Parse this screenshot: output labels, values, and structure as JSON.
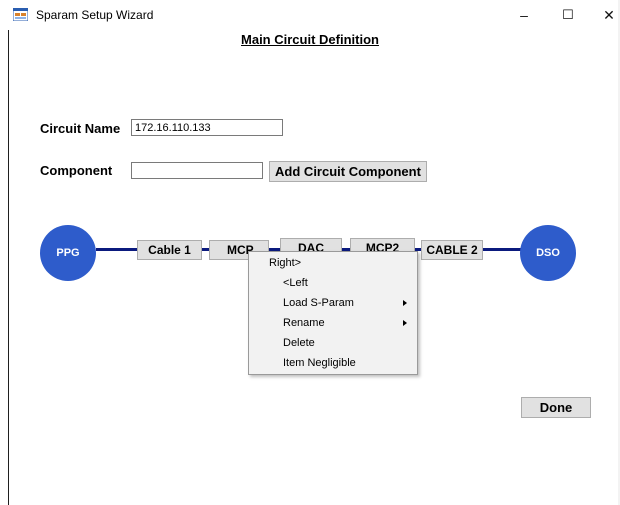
{
  "window": {
    "title": "Sparam Setup Wizard",
    "minimize_glyph": "–",
    "maximize_glyph": "☐",
    "close_glyph": "✕",
    "icon": "app-window-icon"
  },
  "main": {
    "heading": "Main Circuit Definition",
    "circuit_name_label": "Circuit Name",
    "circuit_name_value": "172.16.110.133",
    "component_label": "Component",
    "component_value": "",
    "add_button_label": "Add Circuit Component",
    "done_button_label": "Done"
  },
  "circuit": {
    "source_node": "PPG",
    "sink_node": "DSO",
    "components": [
      "Cable 1",
      "MCP",
      "DAC",
      "MCP2",
      "CABLE 2"
    ],
    "wire_color": "#0b1a7e",
    "node_color": "#2e5ccb"
  },
  "context_menu": {
    "items": [
      {
        "label": "Right>",
        "submenu": false
      },
      {
        "label": "<Left",
        "submenu": false
      },
      {
        "label": "Load S-Param",
        "submenu": true
      },
      {
        "label": "Rename",
        "submenu": true
      },
      {
        "label": "Delete",
        "submenu": false
      },
      {
        "label": "Item Negligible",
        "submenu": false
      }
    ]
  }
}
